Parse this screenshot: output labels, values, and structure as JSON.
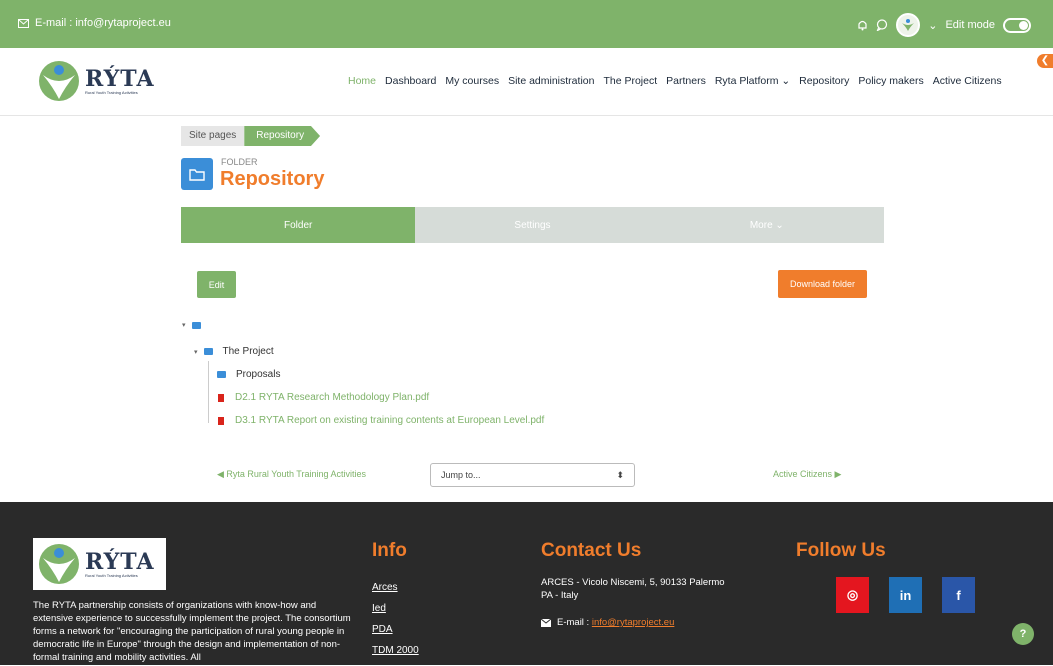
{
  "topbar": {
    "email": "E-mail : info@rytaproject.eu",
    "edit_mode": "Edit mode",
    "dropdown_caret": "⌄"
  },
  "brand": {
    "name": "RÝTA",
    "tagline": "Rural Youth Training Activities",
    "collapse_glyph": "❮"
  },
  "nav": [
    {
      "label": "Home",
      "active": true
    },
    {
      "label": "Dashboard"
    },
    {
      "label": "My courses"
    },
    {
      "label": "Site administration"
    },
    {
      "label": "The Project"
    },
    {
      "label": "Partners"
    },
    {
      "label": "Ryta Platform ⌄"
    },
    {
      "label": "Repository"
    },
    {
      "label": "Policy makers"
    },
    {
      "label": "Active Citizens"
    }
  ],
  "breadcrumb": {
    "item1": "Site pages",
    "item2": "Repository"
  },
  "header": {
    "pretitle": "FOLDER",
    "title": "Repository"
  },
  "tabs": {
    "folder": "Folder",
    "settings": "Settings",
    "more": "More ⌄"
  },
  "actions": {
    "edit": "Edit",
    "download": "Download folder"
  },
  "tree": {
    "root_caret": "▾",
    "project_caret": "▾",
    "project": "The Project",
    "proposals": "Proposals",
    "file1": "D2.1 RYTA Research Methodology Plan.pdf",
    "file2": "D3.1 RYTA Report on existing training contents at European Level.pdf"
  },
  "pager": {
    "prev": "◀ Ryta Rural Youth Training Activities",
    "jump_placeholder": "Jump to...",
    "jump_arrows": "⬍",
    "next": "Active Citizens ▶"
  },
  "footer": {
    "description": "The RYTA partnership consists of organizations with know-how and extensive experience to successfully implement the project. The consortium forms a network for \"encouraging the participation of rural young people in democratic life in Europe\" through the design and implementation of non-formal training and mobility activities. All",
    "info_heading": "Info",
    "info_links": [
      "Arces",
      "Ied",
      "PDA",
      "TDM 2000"
    ],
    "contact_heading": "Contact Us",
    "address": "ARCES - Vicolo Niscemi, 5, 90133 Palermo PA - Italy",
    "email_label": "E-mail : ",
    "email_value": "info@rytaproject.eu",
    "follow_heading": "Follow Us",
    "social": {
      "instagram": "◎",
      "linkedin": "in",
      "facebook": "f"
    }
  },
  "help": "?",
  "colors": {
    "green": "#7fb36a",
    "orange": "#f07d2c",
    "blue": "#3b8ed8",
    "dark": "#2a2a2a"
  }
}
